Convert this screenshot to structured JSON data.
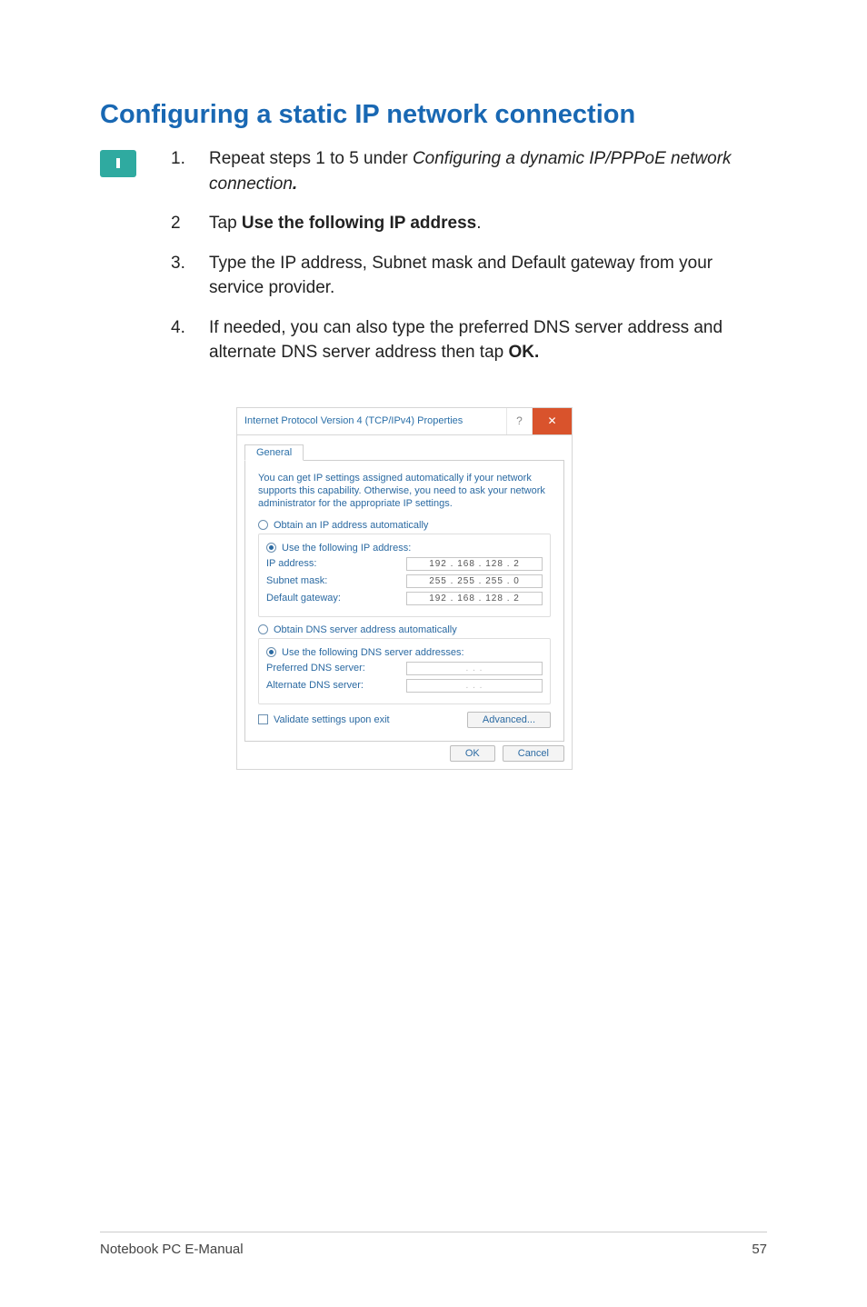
{
  "section_title": "Configuring a static IP network connection",
  "steps": [
    {
      "num": "1.",
      "pre": "Repeat steps 1 to 5 under ",
      "italic": "Configuring a dynamic IP/PPPoE network connection",
      "bold_suffix": "."
    },
    {
      "num": "2",
      "pre": "Tap ",
      "bold": "Use the following IP address",
      "post": "."
    },
    {
      "num": "3.",
      "plain": "Type the IP address, Subnet mask and Default gateway from your service provider."
    },
    {
      "num": "4.",
      "pre": "If needed, you can also type the preferred DNS server address and alternate DNS server address then tap ",
      "bold": "OK."
    }
  ],
  "dialog": {
    "title": "Internet Protocol Version 4 (TCP/IPv4) Properties",
    "tab_label": "General",
    "description": "You can get IP settings assigned automatically if your network supports this capability. Otherwise, you need to ask your network administrator for the appropriate IP settings.",
    "ip_auto": "Obtain an IP address automatically",
    "ip_manual": "Use the following IP address:",
    "ip_address_label": "IP address:",
    "ip_address_value": "192 . 168 . 128 .  2",
    "subnet_label": "Subnet mask:",
    "subnet_value": "255 . 255 . 255 .  0",
    "gateway_label": "Default gateway:",
    "gateway_value": "192 . 168 . 128 .  2",
    "dns_auto": "Obtain DNS server address automatically",
    "dns_manual": "Use the following DNS server addresses:",
    "pref_dns_label": "Preferred DNS server:",
    "pref_dns_value": ".       .       .",
    "alt_dns_label": "Alternate DNS server:",
    "alt_dns_value": ".       .       .",
    "validate_label": "Validate settings upon exit",
    "advanced_label": "Advanced...",
    "ok_label": "OK",
    "cancel_label": "Cancel"
  },
  "footer": {
    "left": "Notebook PC E-Manual",
    "right": "57"
  }
}
